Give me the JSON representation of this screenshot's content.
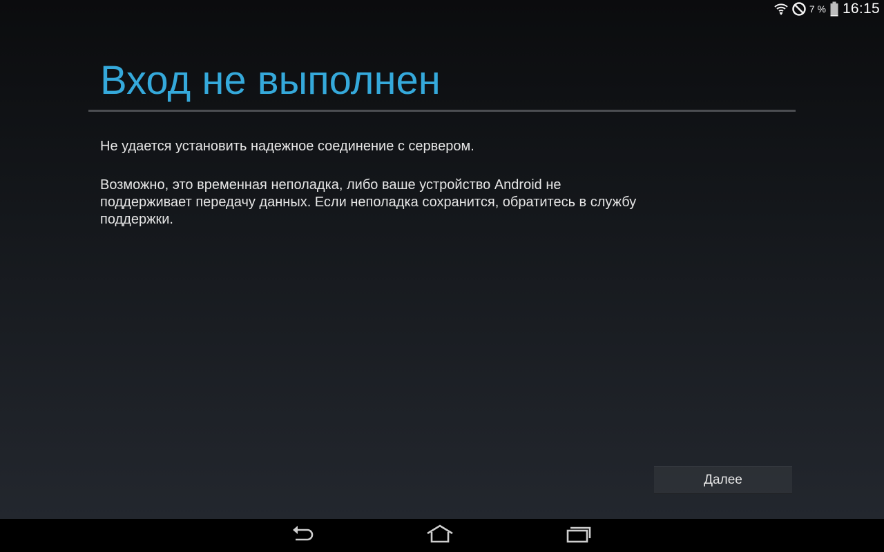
{
  "status_bar": {
    "icons": [
      "wifi-icon",
      "no-sim-icon",
      "battery-icon"
    ],
    "battery_percent": "7 %",
    "battery_level": 0.07,
    "time": "16:15"
  },
  "dialog": {
    "title": "Вход не выполнен",
    "message_primary": "Не удается установить надежное соединение с сервером.",
    "message_secondary": "Возможно, это временная неполадка, либо ваше устройство Android не поддерживает передачу данных. Если неполадка сохранится, обратитесь в службу поддержки.",
    "next_label": "Далее"
  },
  "nav_bar": {
    "buttons": [
      "back-icon",
      "home-icon",
      "recents-icon"
    ]
  },
  "colors": {
    "title_accent": "#35a9db",
    "divider": "#4c4e52",
    "body_text": "#e6e6e6"
  }
}
